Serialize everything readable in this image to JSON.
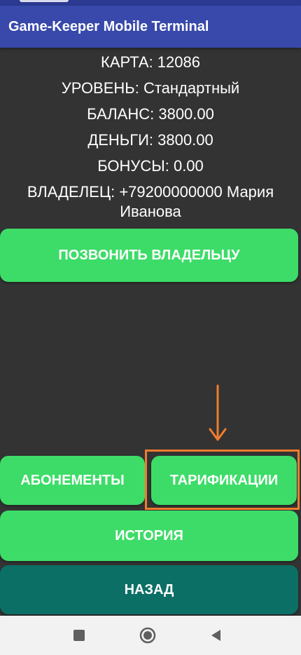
{
  "app": {
    "title": "Game-Keeper Mobile Terminal"
  },
  "card_info": {
    "card": "КАРТА: 12086",
    "level": "УРОВЕНЬ: Стандартный",
    "balance": "БАЛАНС: 3800.00",
    "money": "ДЕНЬГИ: 3800.00",
    "bonuses": "БОНУСЫ: 0.00",
    "owner": "ВЛАДЕЛЕЦ: +79200000000 Мария Иванова"
  },
  "buttons": {
    "call_owner": "ПОЗВОНИТЬ ВЛАДЕЛЬЦУ",
    "subscriptions": "АБОНЕМЕНТЫ",
    "tariffs": "ТАРИФИКАЦИИ",
    "history": "ИСТОРИЯ",
    "back": "НАЗАД"
  },
  "colors": {
    "app_bar": "#3849ab",
    "background": "#333333",
    "green_button": "#3ddc68",
    "teal_button": "#0b6f66",
    "highlight": "#f07c2d"
  },
  "icons": {
    "annotation": "arrow-down-icon",
    "nav_recents": "square-icon",
    "nav_home": "circle-home-icon",
    "nav_back": "triangle-back-icon"
  }
}
